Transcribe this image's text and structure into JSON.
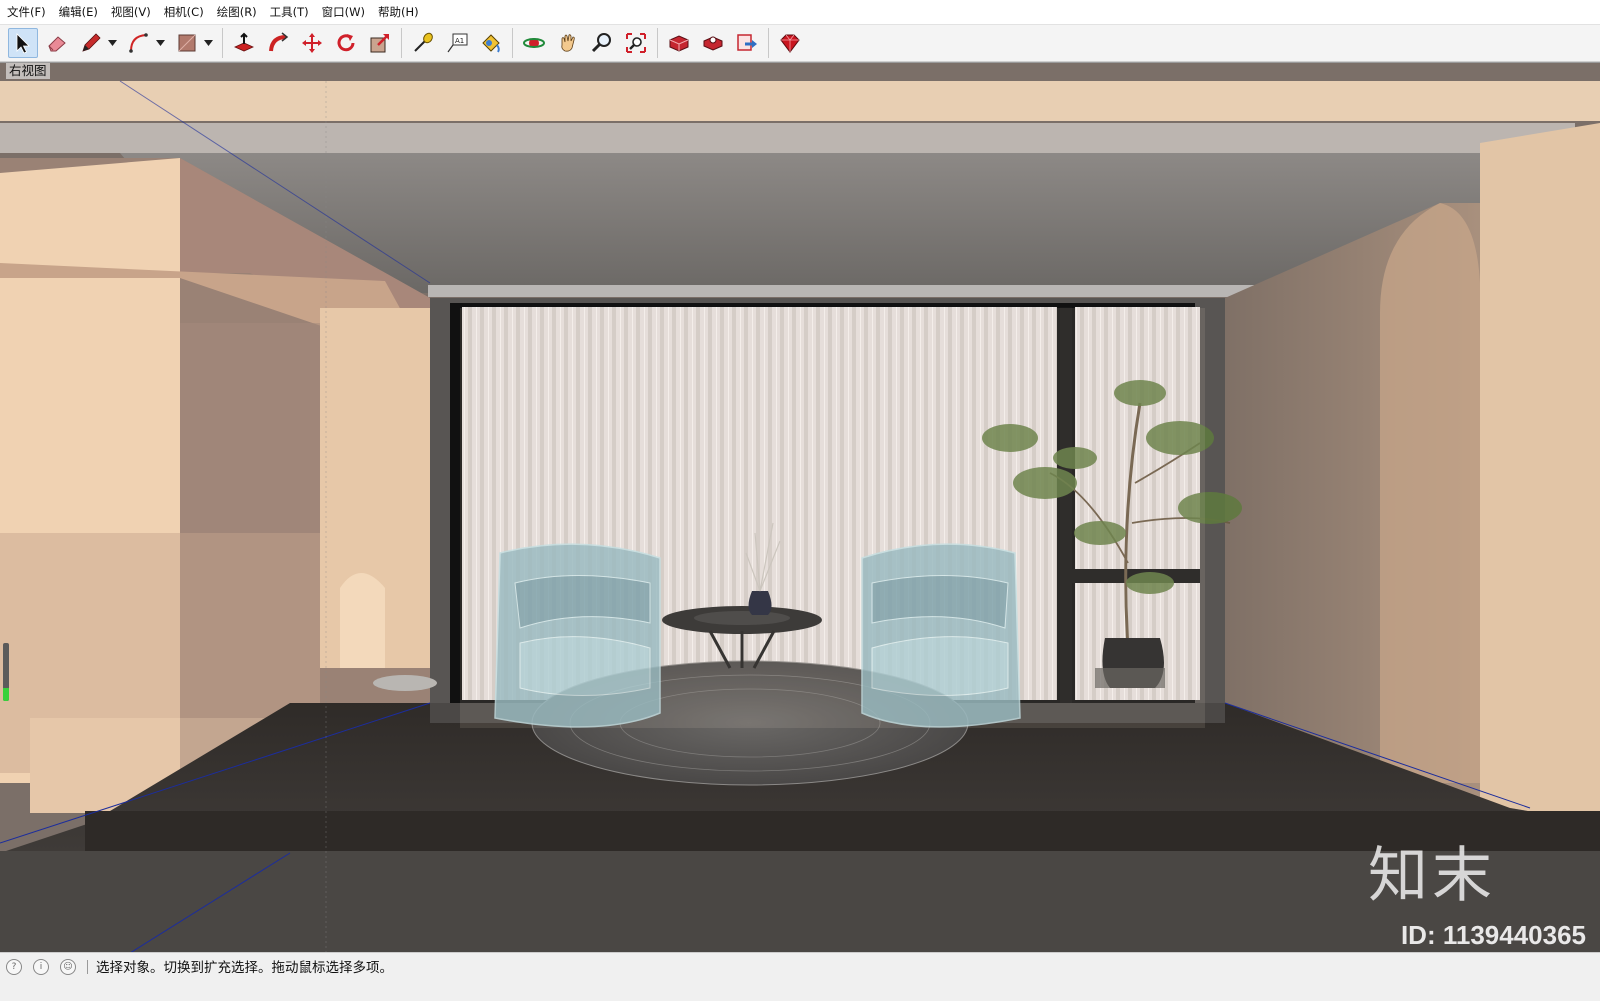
{
  "menu": [
    {
      "label": "文件(F)"
    },
    {
      "label": "编辑(E)"
    },
    {
      "label": "视图(V)"
    },
    {
      "label": "相机(C)"
    },
    {
      "label": "绘图(R)"
    },
    {
      "label": "工具(T)"
    },
    {
      "label": "窗口(W)"
    },
    {
      "label": "帮助(H)"
    }
  ],
  "toolbar": {
    "tools": [
      "select-icon",
      "eraser-icon",
      "pencil-icon",
      "arc-icon",
      "rectangle-icon",
      "push-pull-icon",
      "follow-me-icon",
      "move-icon",
      "rotate-icon",
      "scale-icon",
      "tape-measure-icon",
      "text-icon",
      "paint-bucket-icon",
      "orbit-icon",
      "pan-icon",
      "zoom-icon",
      "zoom-extents-icon",
      "3d-warehouse-icon",
      "extension-warehouse-icon",
      "layout-send-icon",
      "ruby-console-icon"
    ],
    "active_tool": "select-icon"
  },
  "viewport": {
    "view_label": "右视图",
    "watermark_brand": "知末",
    "watermark_id": "ID: 1139440365"
  },
  "status": {
    "message": "选择对象。切换到扩充选择。拖动鼠标选择多项。"
  }
}
